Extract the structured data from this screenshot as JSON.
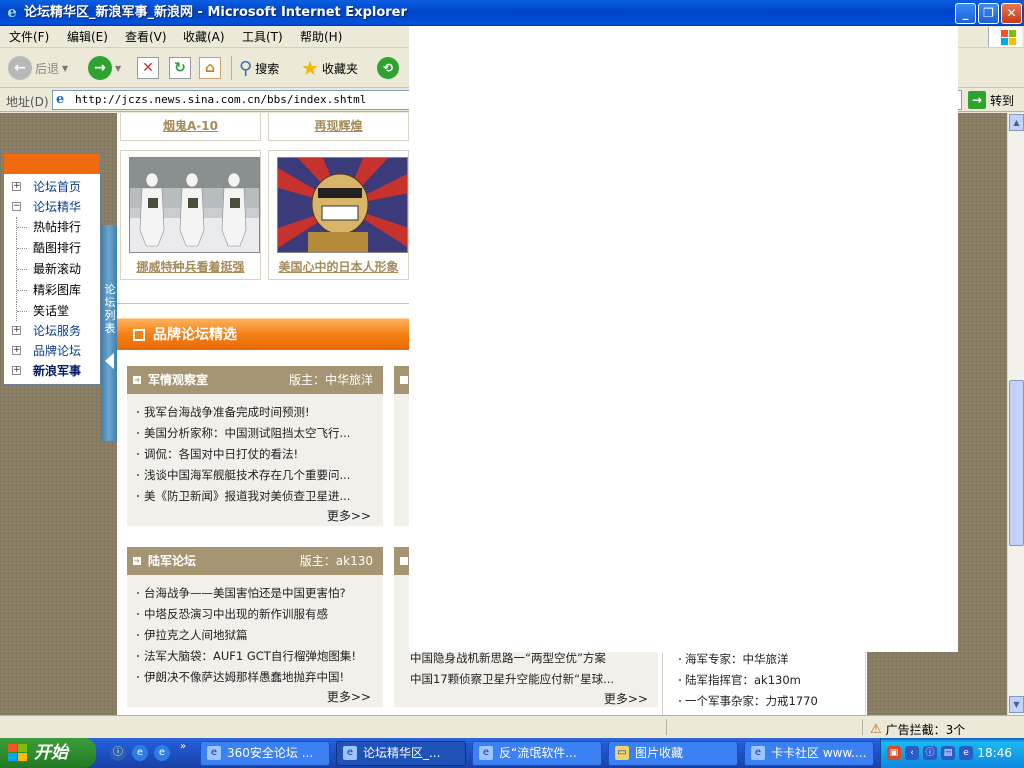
{
  "window": {
    "title": "论坛精华区_新浪军事_新浪网 - Microsoft Internet Explorer",
    "buttons": [
      "_",
      "❐",
      "✕"
    ]
  },
  "menu": [
    "文件(F)",
    "编辑(E)",
    "查看(V)",
    "收藏(A)",
    "工具(T)",
    "帮助(H)"
  ],
  "toolbar": {
    "back": "后退",
    "search": "搜索",
    "favorites": "收藏夹"
  },
  "address": {
    "label": "地址(D)",
    "url": "http://jczs.news.sina.com.cn/bbs/index.shtml",
    "go": "转到"
  },
  "sidebar": {
    "items": [
      {
        "label": "论坛首页",
        "kind": "plus"
      },
      {
        "label": "论坛精华",
        "kind": "minus"
      },
      {
        "label": "热帖排行",
        "kind": "child"
      },
      {
        "label": "酷图排行",
        "kind": "child"
      },
      {
        "label": "最新滚动",
        "kind": "child"
      },
      {
        "label": "精彩图库",
        "kind": "child"
      },
      {
        "label": "笑话堂",
        "kind": "child"
      },
      {
        "label": "论坛服务",
        "kind": "plus"
      },
      {
        "label": "品牌论坛",
        "kind": "plus"
      },
      {
        "label": "新浪军事",
        "kind": "plus-bold"
      }
    ],
    "vertical_tab": "论坛列表"
  },
  "gallery": {
    "top_captions": [
      "烟鬼A-10",
      "再现辉煌"
    ],
    "cards": [
      {
        "caption": "挪威特种兵看着挺强"
      },
      {
        "caption": "美国心中的日本人形象"
      }
    ]
  },
  "brand_section": {
    "title": "品牌论坛精选"
  },
  "panels": [
    {
      "title": "军情观察室",
      "moderator": "版主：中华旅洋",
      "items": [
        "我军台海战争准备完成时间预测!",
        "美国分析家称：中国测试阻挡太空飞行...",
        "调侃：各国对中日打仗的看法!",
        "浅谈中国海军舰艇技术存在几个重要问...",
        "美《防卫新闻》报道我对美侦查卫星进..."
      ],
      "more": "更多>>"
    },
    {
      "title": "陆军论坛",
      "moderator": "版主：ak130",
      "items": [
        "台海战争——美国害怕还是中国更害怕?",
        "中塔反恐演习中出现的新作训服有感",
        "伊拉克之人间地狱篇",
        "法军大脑袋：AUF1 GCT自行榴弹炮图集!",
        "伊朗决不像萨达姆那样愚蠢地抛弃中国!"
      ],
      "more": "更多>>"
    }
  ],
  "middle_panel_bottom": {
    "items": [
      "中国隐身战机新思路一“两型空优”方案",
      "中国17颗侦察卫星升空能应付新“星球..."
    ],
    "more": "更多>>"
  },
  "right_panel_bottom": {
    "items": [
      "海军专家：中华旅洋",
      "陆军指挥官：ak130m",
      "一个军事杂家：力戒1770"
    ]
  },
  "status": {
    "popup_blocked": "广告拦截：3个"
  },
  "taskbar": {
    "start": "开始",
    "tasks": [
      {
        "label": "360安全论坛 ...",
        "active": false
      },
      {
        "label": "论坛精华区_...",
        "active": true
      },
      {
        "label": "反“流氓软件...",
        "active": false
      },
      {
        "label": "图片收藏",
        "active": false
      },
      {
        "label": "卡卡社区 www....",
        "active": false
      }
    ],
    "clock": "18:46"
  },
  "colors": {
    "accent_orange": "#f57f15",
    "panel_header": "#a59572",
    "link_gold": "#a68b5b"
  }
}
